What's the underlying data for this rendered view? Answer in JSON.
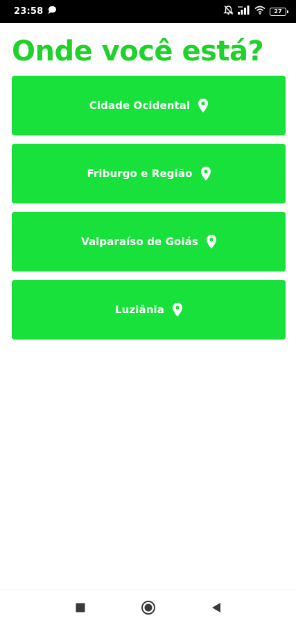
{
  "status_bar": {
    "time": "23:58",
    "battery_level": "27",
    "icons": [
      "chat-bubble-icon",
      "alarm-off-icon",
      "signal-icon",
      "wifi-icon",
      "battery-icon"
    ]
  },
  "page": {
    "title": "Onde você está?"
  },
  "locations": [
    {
      "label": "Cidade Ocidental",
      "icon": "map-pin-icon"
    },
    {
      "label": "Friburgo e Região",
      "icon": "map-pin-icon"
    },
    {
      "label": "Valparaíso de Goiás",
      "icon": "map-pin-icon"
    },
    {
      "label": "Luziânia",
      "icon": "map-pin-icon"
    }
  ],
  "nav_bar": {
    "buttons": [
      "recents-square-icon",
      "home-circle-icon",
      "back-triangle-icon"
    ]
  },
  "colors": {
    "accent": "#1fd12b",
    "button_bg": "#17e13a",
    "status_bar_bg": "#000000",
    "background": "#ffffff"
  }
}
